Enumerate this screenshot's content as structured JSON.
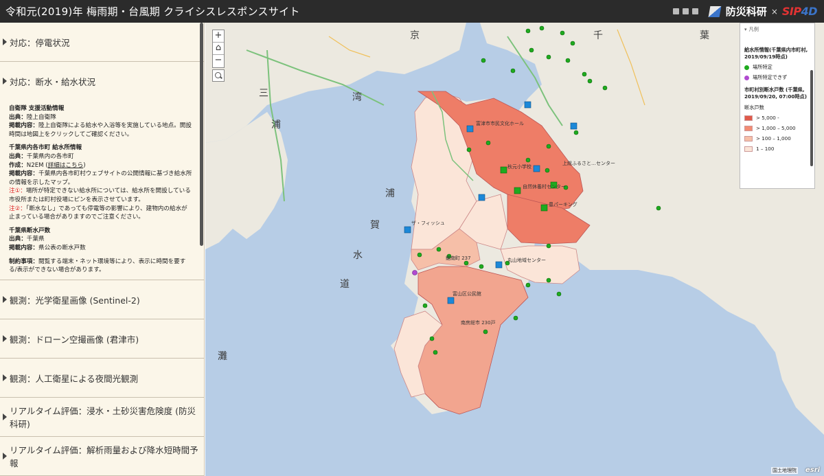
{
  "header": {
    "title": "令和元(2019)年 梅雨期・台風期 クライシスレスポンスサイト",
    "brand_name": "防災科研",
    "brand_x": "×",
    "sip_a": "SIP",
    "sip_b": "4D"
  },
  "sidebar": {
    "items_top": [
      {
        "label": "対応：停電状況"
      }
    ],
    "open_item": {
      "label": "対応：断水・給水状況",
      "sections": [
        {
          "heading": "自衛隊 支援活動情報",
          "source_label": "出典：",
          "source": "陸上自衛隊",
          "content_label": "掲載内容：",
          "content": "陸上自衛隊による給水や入浴等を実施している地点。開設時間は地図上をクリックしてご確認ください。"
        },
        {
          "heading": "千葉県内各市町 給水所情報",
          "source_label": "出典：",
          "source": "千葉県内の各市町",
          "author_label": "作成：",
          "author": "N2EM (",
          "author_link": "詳細はこちら",
          "author_tail": ")",
          "content_label": "掲載内容：",
          "content": "千葉県内各市町村ウェブサイトの公開情報に基づき給水所の情報を示したマップ。",
          "note1_label": "注①：",
          "note1": "場所が特定できない給水所については、給水所を開設している市役所または町村役場にピンを表示させています。",
          "note2_label": "注②：",
          "note2": "「断水なし」であっても停電等の影響により、建物内の給水が止まっている場合がありますのでご注意ください。"
        },
        {
          "heading": "千葉県断水戸数",
          "source_label": "出典：",
          "source": "千葉県",
          "content_label": "掲載内容：",
          "content": "県公表の断水戸数"
        },
        {
          "heading_inline": "制約事項：",
          "content": "閲覧する端末・ネット環境等により、表示に時間を要する/表示ができない場合があります。"
        }
      ]
    },
    "items_bottom": [
      {
        "label": "観測：光学衛星画像 (Sentinel-2)"
      },
      {
        "label": "観測：ドローン空撮画像 (君津市)"
      },
      {
        "label": "観測：人工衛星による夜間光観測"
      },
      {
        "label": "リアルタイム評価：浸水・土砂災害危険度 (防災科研)"
      },
      {
        "label": "リアルタイム評価：解析雨量および降水短時間予報"
      }
    ]
  },
  "map": {
    "zoom_in": "+",
    "home": "⌂",
    "zoom_out": "−",
    "legend": {
      "header": "凡例",
      "sec1": "給水所情報(千葉県内市町村, 2019/09/19時点)",
      "sec1_items": [
        {
          "label": "場所特定",
          "color": "#1faa1f"
        },
        {
          "label": "場所特定できず",
          "color": "#b04ad0"
        }
      ],
      "sec2": "市町村別断水戸数 (千葉県, 2019/09/20, 07:00時点)",
      "sec2_sub": "断水戸数",
      "sec2_items": [
        {
          "label": "> 5,000 -",
          "color": "#e05a4a"
        },
        {
          "label": "> 1,000 – 5,000",
          "color": "#f28c74"
        },
        {
          "label": "> 100 – 1,000",
          "color": "#f6bfa8"
        },
        {
          "label": "1 – 100",
          "color": "#fbe5d8"
        }
      ]
    },
    "labels": [
      {
        "text": "ザ・フィッシュ"
      },
      {
        "text": "秋元小学校"
      },
      {
        "text": "富津市市民文化ホール"
      },
      {
        "text": "上総ふるさと…センター"
      },
      {
        "text": "自然休養村センター"
      },
      {
        "text": "鋸南町 237"
      },
      {
        "text": "丸山地域センター"
      },
      {
        "text": "富山区公民館"
      },
      {
        "text": "南房総市 230戸"
      },
      {
        "text": "豊パーキング"
      }
    ],
    "sea_labels": [
      "湾",
      "浦",
      "賀",
      "水",
      "道",
      "京",
      "千",
      "葉",
      "灘",
      "三",
      "浦"
    ],
    "credit": "国土地理院",
    "esri": "esri"
  }
}
